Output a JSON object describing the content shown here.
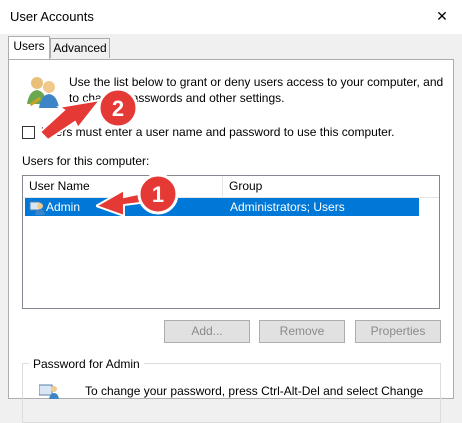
{
  "window": {
    "title": "User Accounts",
    "close_glyph": "✕"
  },
  "tabs": [
    {
      "label": "Users"
    },
    {
      "label": "Advanced"
    }
  ],
  "intro_text": "Use the list below to grant or deny users access to your computer, and to change passwords and other settings.",
  "checkbox": {
    "label": "Users must enter a user name and password to use this computer.",
    "checked": false
  },
  "users_label": "Users for this computer:",
  "list": {
    "columns": [
      "User Name",
      "Group"
    ],
    "rows": [
      {
        "user": "Admin",
        "group": "Administrators; Users",
        "selected": true
      }
    ]
  },
  "buttons": {
    "add": "Add...",
    "remove": "Remove",
    "properties": "Properties"
  },
  "password_group": {
    "title": "Password for Admin",
    "text": "To change your password, press Ctrl-Alt-Del and select Change"
  },
  "annotations": [
    {
      "number": "1",
      "color": "#e53935"
    },
    {
      "number": "2",
      "color": "#e53935"
    }
  ]
}
